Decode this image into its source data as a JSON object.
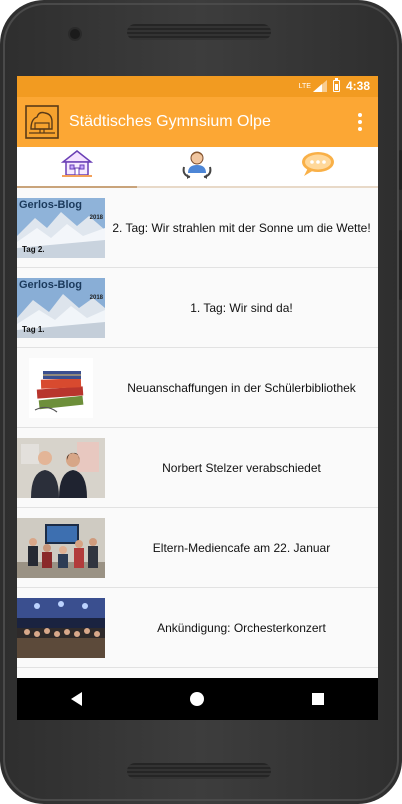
{
  "status_bar": {
    "network": "LTE",
    "time": "4:38"
  },
  "app_bar": {
    "title": "Städtisches Gymnsium Olpe",
    "logo_icon": "school-logo-icon",
    "menu_icon": "more-vert-icon"
  },
  "tabs": [
    {
      "icon": "school-house-icon",
      "active": true
    },
    {
      "icon": "contact-person-icon",
      "active": false
    },
    {
      "icon": "chat-bubble-icon",
      "active": false
    }
  ],
  "news": [
    {
      "title": "2. Tag: Wir strahlen mit der Sonne um die Wette!",
      "thumb_title": "Gerlos-Blog",
      "thumb_year": "2018",
      "thumb_tag": "Tag 2."
    },
    {
      "title": "1. Tag: Wir sind da!",
      "thumb_title": "Gerlos-Blog",
      "thumb_year": "2018",
      "thumb_tag": "Tag 1."
    },
    {
      "title": "Neuanschaffungen in der Schülerbibliothek"
    },
    {
      "title": "Norbert Stelzer verabschiedet"
    },
    {
      "title": "Eltern-Mediencafe am 22. Januar"
    },
    {
      "title": "Ankündigung: Orchesterkonzert"
    }
  ],
  "nav_bar": {
    "back_icon": "back-triangle-icon",
    "home_icon": "home-circle-icon",
    "recents_icon": "recents-square-icon"
  },
  "colors": {
    "status_bar": "#f29b21",
    "app_bar": "#fca734",
    "accent": "#c9a47b"
  }
}
